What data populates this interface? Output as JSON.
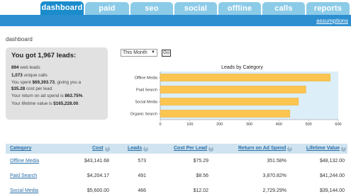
{
  "tabs": [
    {
      "label": "dashboard",
      "active": true
    },
    {
      "label": "paid search",
      "active": false
    },
    {
      "label": "seo",
      "active": false
    },
    {
      "label": "social",
      "active": false
    },
    {
      "label": "offline",
      "active": false
    },
    {
      "label": "calls",
      "active": false
    },
    {
      "label": "reports",
      "active": false
    }
  ],
  "assumptions_label": "assumptions",
  "page_title": "dashboard",
  "summary": {
    "headline": "You got 1,967 leads:",
    "web_leads_count": "894",
    "web_leads_text": " web leads",
    "unique_calls_count": "1,073",
    "unique_calls_text": " unique calls",
    "spent_prefix": "You spent ",
    "spent_value": "$69,393.73",
    "spent_suffix": ", giving you a",
    "cpl_value": "$35.28",
    "cpl_suffix": " cost per lead.",
    "roas_prefix": "Your return on ad spend is ",
    "roas_value": "863.75%",
    "roas_suffix": ".",
    "ltv_prefix": "Your lifetime value is ",
    "ltv_value": "$165,228.00",
    "ltv_suffix": "."
  },
  "period_select": {
    "value": "This Month"
  },
  "go_label": "Go",
  "colors": {
    "tab": "#8ccbe8",
    "tab_active": "#1a8ccc",
    "bar": "#fbc550",
    "bar_stroke": "#e8a830",
    "plot_bg": "#dceef8",
    "header_bg": "#cfe3f0"
  },
  "chart_data": {
    "type": "bar",
    "orientation": "horizontal",
    "title": "Leads by Category",
    "categories": [
      "Offline Media",
      "Paid Search",
      "Social Media",
      "Organic Search"
    ],
    "values": [
      573,
      491,
      466,
      437
    ],
    "xlim": [
      0,
      600
    ],
    "xticks": [
      "0",
      "100",
      "200",
      "300",
      "400",
      "500",
      "600"
    ],
    "grid": false,
    "legend": "none"
  },
  "table": {
    "columns": [
      "Category",
      "Cost",
      "Leads",
      "Cost Per Lead",
      "Return on Ad Spend",
      "Lifetime Value"
    ],
    "rows": [
      [
        "Offline Media",
        "$43,141.68",
        "573",
        "$75.29",
        "351.58%",
        "$48,132.00"
      ],
      [
        "Paid Search",
        "$4,204.17",
        "491",
        "$8.56",
        "3,870.82%",
        "$41,244.00"
      ],
      [
        "Social Media",
        "$5,600.00",
        "466",
        "$12.02",
        "2,729.29%",
        "$39,144.00"
      ]
    ]
  }
}
